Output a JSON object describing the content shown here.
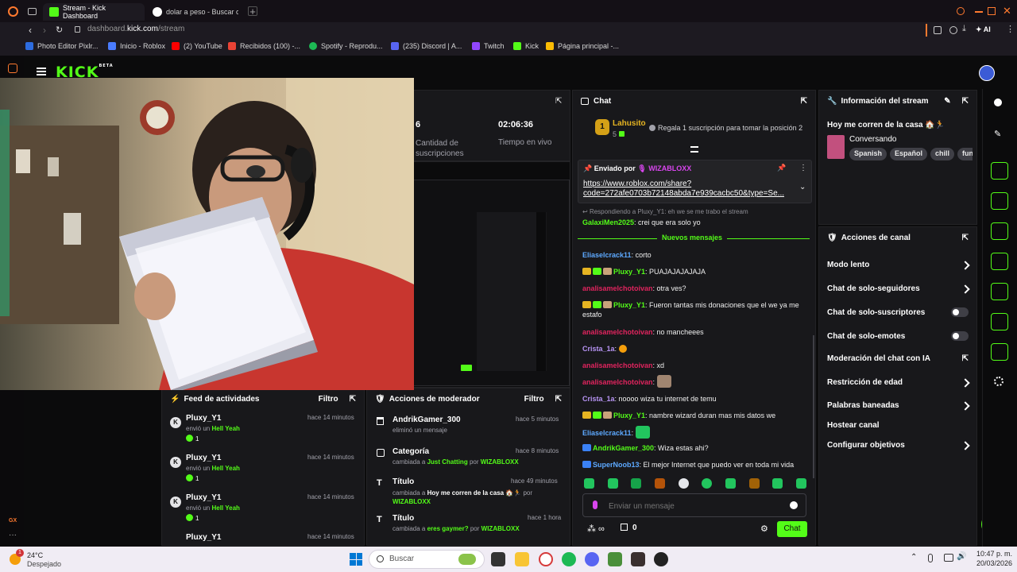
{
  "browser": {
    "tabs": [
      {
        "label": "Stream - Kick Dashboard",
        "active": true
      },
      {
        "label": "dolar a peso - Buscar con",
        "active": false
      }
    ],
    "url_prefix": "dashboard.",
    "url_domain": "kick.com",
    "url_path": "/stream",
    "ai_label": "AI",
    "bookmarks": [
      "Photo Editor Pixlr...",
      "Inicio - Roblox",
      "(2) YouTube",
      "Recibidos (100) -...",
      "Spotify - Reprodu...",
      "(235) Discord | A...",
      "Twitch",
      "Kick",
      "Página principal -..."
    ],
    "gx_label": "GX"
  },
  "kick": {
    "logo": "KICK",
    "logo_beta": "BETA",
    "stats": {
      "subs_value": "6",
      "subs_label": "Cantidad de suscripciones",
      "live_value": "02:06:36",
      "live_label": "Tiempo en vivo"
    },
    "chat": {
      "title": "Chat",
      "top_user": "Lahusito",
      "top_rank": "1",
      "top_count": "5",
      "top_promo": "Regala 1 suscripción para tomar la posición 2",
      "pinned_by_label": "Enviado por",
      "pinned_user": "WIZABLOXX",
      "pinned_link_1": "https://www.roblox.com/share?",
      "pinned_link_2": "code=272afe0703b72148abda7e939cacbc50&type=Se...",
      "reply_hint": "Respondiendo a Pluxy_Y1: eh we se me trabo el stream",
      "reply_user": "GalaxiMen2025",
      "reply_text": ": crei que era solo yo",
      "new_messages": "Nuevos mensajes",
      "messages": [
        {
          "user": "Eliaselcrack11",
          "text": ": corto",
          "color": "#5da9ff"
        },
        {
          "user": "Pluxy_Y1",
          "text": ": PUAJAJAJAJAJA",
          "color": "#53fc18"
        },
        {
          "user": "analisamelchotoivan",
          "text": ": otra ves?",
          "color": "#e0245e"
        },
        {
          "user": "Pluxy_Y1",
          "text": ": Fueron tantas mis donaciones que el we ya me",
          "color": "#53fc18"
        },
        {
          "user": "",
          "text": "estafo",
          "color": "#ffffff"
        },
        {
          "user": "analisamelchotoivan",
          "text": ": no mancheees",
          "color": "#e0245e"
        },
        {
          "user": "Crista_1a",
          "text": ":",
          "color": "#b794f4"
        },
        {
          "user": "analisamelchotoivan",
          "text": ": xd",
          "color": "#e0245e"
        },
        {
          "user": "analisamelchotoivan",
          "text": ":",
          "color": "#e0245e"
        },
        {
          "user": "Crista_1a",
          "text": ": noooo wiza tu internet de temu",
          "color": "#b794f4"
        },
        {
          "user": "Pluxy_Y1",
          "text": ": nambre wizard duran mas mis datos we",
          "color": "#53fc18"
        },
        {
          "user": "Eliaselcrack11",
          "text": ":",
          "color": "#5da9ff"
        },
        {
          "user": "AndrikGamer_300",
          "text": ": Wiza estas ahi?",
          "color": "#53fc18"
        },
        {
          "user": "SuperNoob13",
          "text": ": El mejor Internet que puedo ver en toda mi vida",
          "color": "#5da9ff"
        }
      ],
      "input_placeholder": "Enviar un mensaje",
      "viewer_count": "0",
      "send_label": "Chat"
    },
    "stream_info": {
      "title": "Información del stream",
      "stream_title": "Hoy me corren de la casa",
      "category": "Conversando",
      "tags": [
        "Spanish",
        "Español",
        "chill",
        "fun"
      ]
    },
    "channel_actions": {
      "title": "Acciones de canal",
      "items": [
        {
          "label": "Modo lento",
          "control": "chevron"
        },
        {
          "label": "Chat de solo-seguidores",
          "control": "chevron"
        },
        {
          "label": "Chat de solo-suscriptores",
          "control": "toggle"
        },
        {
          "label": "Chat de solo-emotes",
          "control": "toggle"
        },
        {
          "label": "Moderación del chat con IA",
          "control": "external"
        },
        {
          "label": "Restricción de edad",
          "control": "chevron"
        },
        {
          "label": "Palabras baneadas",
          "control": "chevron"
        },
        {
          "label": "Hostear canal",
          "control": "none"
        },
        {
          "label": "Configurar objetivos",
          "control": "chevron"
        }
      ]
    },
    "activity_feed": {
      "title": "Feed de actividades",
      "filter": "Filtro",
      "items": [
        {
          "user": "Pluxy_Y1",
          "time": "hace 14 minutos",
          "action": "envió un",
          "gift": "Hell Yeah",
          "count": "1"
        },
        {
          "user": "Pluxy_Y1",
          "time": "hace 14 minutos",
          "action": "envió un",
          "gift": "Hell Yeah",
          "count": "1"
        },
        {
          "user": "Pluxy_Y1",
          "time": "hace 14 minutos",
          "action": "envió un",
          "gift": "Hell Yeah",
          "count": "1"
        },
        {
          "user": "Pluxy_Y1",
          "time": "hace 14 minutos",
          "action": "",
          "gift": "",
          "count": ""
        }
      ]
    },
    "mod_actions": {
      "title": "Acciones de moderador",
      "filter": "Filtro",
      "items": [
        {
          "title": "AndrikGamer_300",
          "time": "hace 5 minutos",
          "line1": "eliminó un mensaje",
          "hl": "",
          "by": "",
          "mod": ""
        },
        {
          "title": "Categoría",
          "time": "hace 8 minutos",
          "line1": "cambiada a",
          "hl": "Just Chatting",
          "by": "por",
          "mod": "WIZABLOXX"
        },
        {
          "title": "Título",
          "time": "hace 49 minutos",
          "line1": "cambiada a",
          "hl": "Hoy me corren de la casa",
          "by": "por",
          "mod": "WIZABLOXX"
        },
        {
          "title": "Título",
          "time": "hace 1 hora",
          "line1": "cambiada a",
          "hl": "eres gaymer?",
          "by": "por",
          "mod": "WIZABLOXX"
        }
      ]
    }
  },
  "taskbar": {
    "weather_temp": "24°C",
    "weather_desc": "Despejado",
    "weather_badge": "1",
    "search_placeholder": "Buscar",
    "time": "10:47 p. m.",
    "date": "20/03/2026"
  },
  "colors": {
    "kick_green": "#53fc18",
    "panel": "#18181b",
    "background": "#0b0b0c"
  }
}
